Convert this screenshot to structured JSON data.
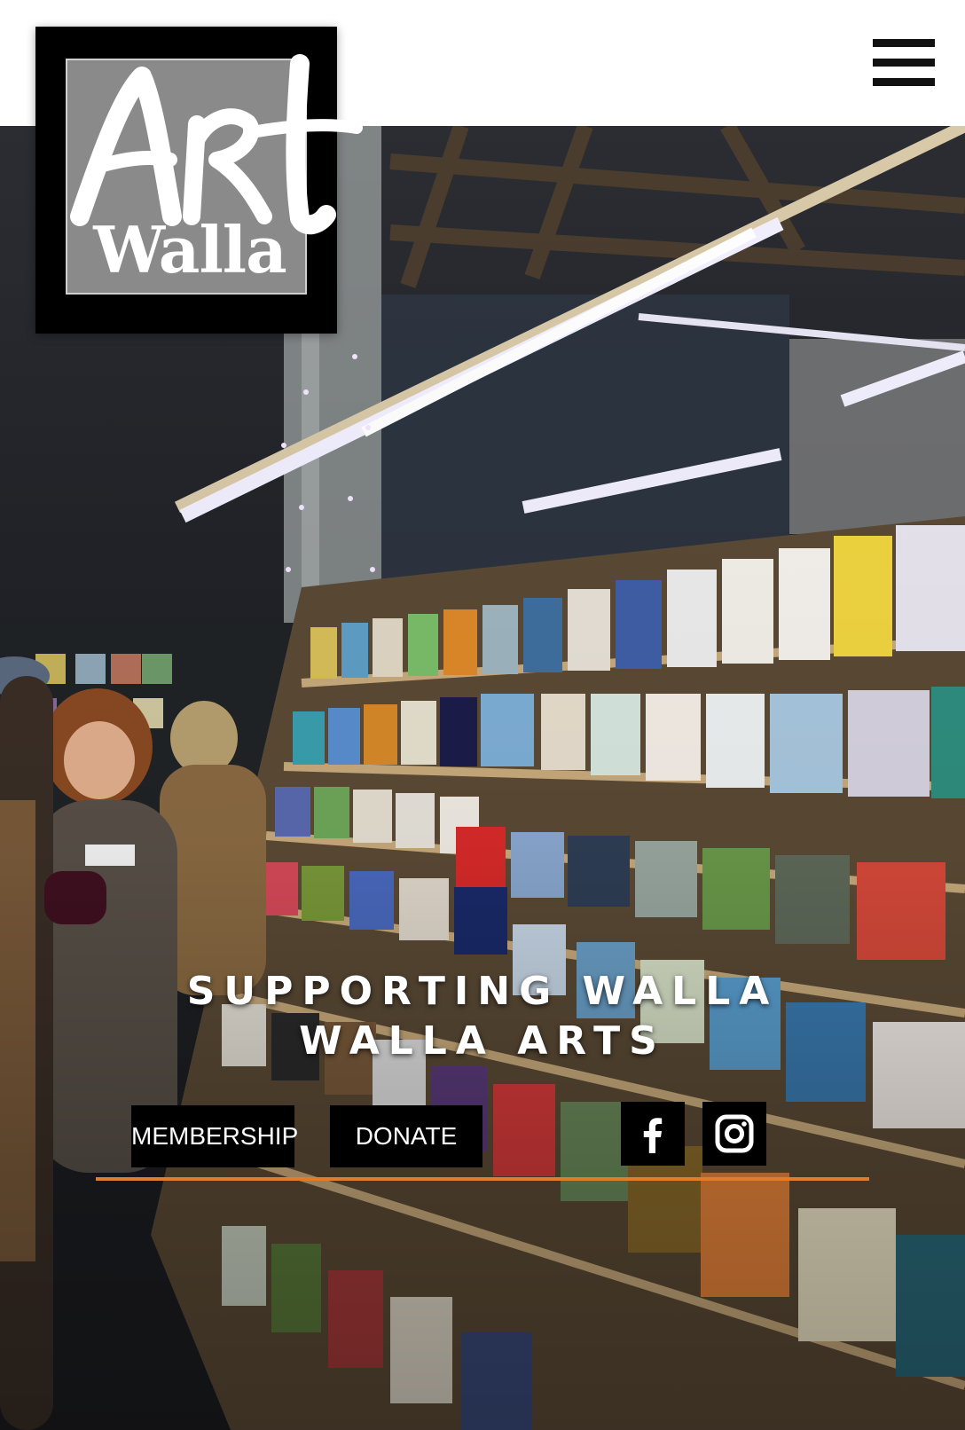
{
  "header": {
    "menu_icon": "hamburger-menu-icon"
  },
  "logo": {
    "line1": "Art",
    "line2": "Walla"
  },
  "hero": {
    "headline_line1": "SUPPORTING WALLA",
    "headline_line2": "WALLA ARTS"
  },
  "actions": {
    "membership_label": "MEMBERSHIP",
    "donate_label": "DONATE"
  },
  "social": {
    "facebook_icon": "facebook-icon",
    "instagram_icon": "instagram-icon"
  },
  "colors": {
    "accent": "#e07c2a",
    "button_bg": "#000000",
    "logo_gray": "#8a8a8a"
  }
}
